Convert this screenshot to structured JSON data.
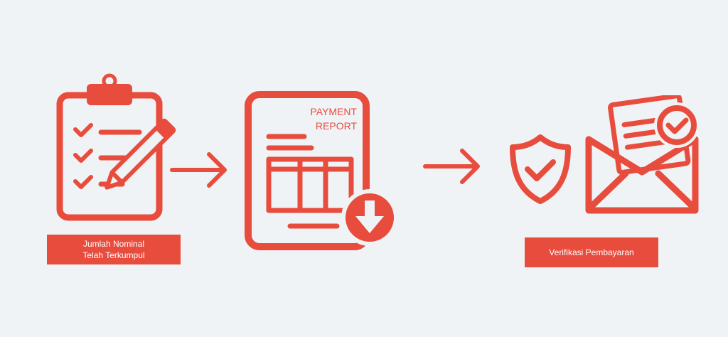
{
  "colors": {
    "background": "#eff3f5",
    "accent": "#e84c3d",
    "text_on_accent": "#ffffff"
  },
  "steps": [
    {
      "icon": "clipboard-checklist-pencil-icon",
      "label_line1": "Jumlah Nominal",
      "label_line2": "Telah Terkumpul"
    },
    {
      "icon": "payment-report-download-icon",
      "report_line1": "PAYMENT",
      "report_line2": "REPORT"
    },
    {
      "icon": "shield-check-and-envelope-check-icon",
      "label": "Verifikasi Pembayaran"
    }
  ],
  "connectors": [
    "arrow-right-icon",
    "arrow-right-icon"
  ]
}
